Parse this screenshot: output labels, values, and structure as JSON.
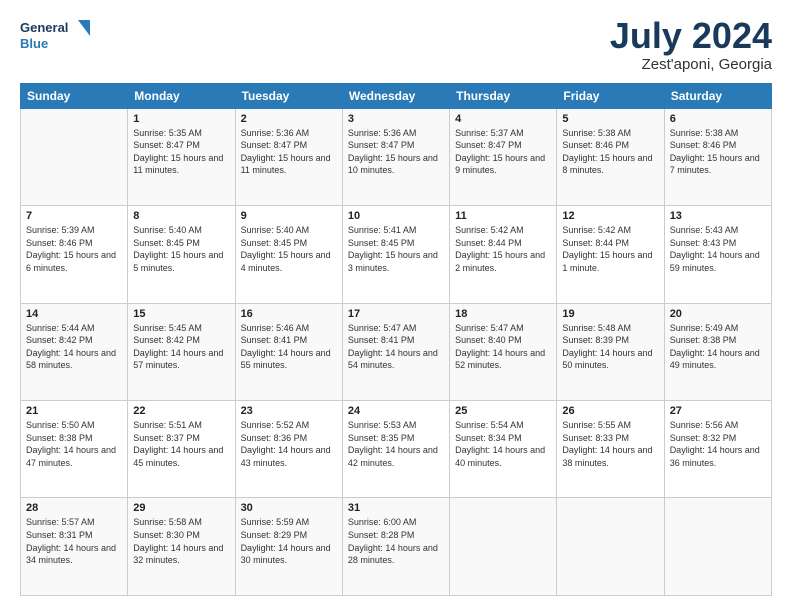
{
  "header": {
    "logo_line1": "General",
    "logo_line2": "Blue",
    "title": "July 2024",
    "location": "Zest'aponi, Georgia"
  },
  "days_of_week": [
    "Sunday",
    "Monday",
    "Tuesday",
    "Wednesday",
    "Thursday",
    "Friday",
    "Saturday"
  ],
  "weeks": [
    [
      {
        "day": "",
        "sunrise": "",
        "sunset": "",
        "daylight": ""
      },
      {
        "day": "1",
        "sunrise": "Sunrise: 5:35 AM",
        "sunset": "Sunset: 8:47 PM",
        "daylight": "Daylight: 15 hours and 11 minutes."
      },
      {
        "day": "2",
        "sunrise": "Sunrise: 5:36 AM",
        "sunset": "Sunset: 8:47 PM",
        "daylight": "Daylight: 15 hours and 11 minutes."
      },
      {
        "day": "3",
        "sunrise": "Sunrise: 5:36 AM",
        "sunset": "Sunset: 8:47 PM",
        "daylight": "Daylight: 15 hours and 10 minutes."
      },
      {
        "day": "4",
        "sunrise": "Sunrise: 5:37 AM",
        "sunset": "Sunset: 8:47 PM",
        "daylight": "Daylight: 15 hours and 9 minutes."
      },
      {
        "day": "5",
        "sunrise": "Sunrise: 5:38 AM",
        "sunset": "Sunset: 8:46 PM",
        "daylight": "Daylight: 15 hours and 8 minutes."
      },
      {
        "day": "6",
        "sunrise": "Sunrise: 5:38 AM",
        "sunset": "Sunset: 8:46 PM",
        "daylight": "Daylight: 15 hours and 7 minutes."
      }
    ],
    [
      {
        "day": "7",
        "sunrise": "Sunrise: 5:39 AM",
        "sunset": "Sunset: 8:46 PM",
        "daylight": "Daylight: 15 hours and 6 minutes."
      },
      {
        "day": "8",
        "sunrise": "Sunrise: 5:40 AM",
        "sunset": "Sunset: 8:45 PM",
        "daylight": "Daylight: 15 hours and 5 minutes."
      },
      {
        "day": "9",
        "sunrise": "Sunrise: 5:40 AM",
        "sunset": "Sunset: 8:45 PM",
        "daylight": "Daylight: 15 hours and 4 minutes."
      },
      {
        "day": "10",
        "sunrise": "Sunrise: 5:41 AM",
        "sunset": "Sunset: 8:45 PM",
        "daylight": "Daylight: 15 hours and 3 minutes."
      },
      {
        "day": "11",
        "sunrise": "Sunrise: 5:42 AM",
        "sunset": "Sunset: 8:44 PM",
        "daylight": "Daylight: 15 hours and 2 minutes."
      },
      {
        "day": "12",
        "sunrise": "Sunrise: 5:42 AM",
        "sunset": "Sunset: 8:44 PM",
        "daylight": "Daylight: 15 hours and 1 minute."
      },
      {
        "day": "13",
        "sunrise": "Sunrise: 5:43 AM",
        "sunset": "Sunset: 8:43 PM",
        "daylight": "Daylight: 14 hours and 59 minutes."
      }
    ],
    [
      {
        "day": "14",
        "sunrise": "Sunrise: 5:44 AM",
        "sunset": "Sunset: 8:42 PM",
        "daylight": "Daylight: 14 hours and 58 minutes."
      },
      {
        "day": "15",
        "sunrise": "Sunrise: 5:45 AM",
        "sunset": "Sunset: 8:42 PM",
        "daylight": "Daylight: 14 hours and 57 minutes."
      },
      {
        "day": "16",
        "sunrise": "Sunrise: 5:46 AM",
        "sunset": "Sunset: 8:41 PM",
        "daylight": "Daylight: 14 hours and 55 minutes."
      },
      {
        "day": "17",
        "sunrise": "Sunrise: 5:47 AM",
        "sunset": "Sunset: 8:41 PM",
        "daylight": "Daylight: 14 hours and 54 minutes."
      },
      {
        "day": "18",
        "sunrise": "Sunrise: 5:47 AM",
        "sunset": "Sunset: 8:40 PM",
        "daylight": "Daylight: 14 hours and 52 minutes."
      },
      {
        "day": "19",
        "sunrise": "Sunrise: 5:48 AM",
        "sunset": "Sunset: 8:39 PM",
        "daylight": "Daylight: 14 hours and 50 minutes."
      },
      {
        "day": "20",
        "sunrise": "Sunrise: 5:49 AM",
        "sunset": "Sunset: 8:38 PM",
        "daylight": "Daylight: 14 hours and 49 minutes."
      }
    ],
    [
      {
        "day": "21",
        "sunrise": "Sunrise: 5:50 AM",
        "sunset": "Sunset: 8:38 PM",
        "daylight": "Daylight: 14 hours and 47 minutes."
      },
      {
        "day": "22",
        "sunrise": "Sunrise: 5:51 AM",
        "sunset": "Sunset: 8:37 PM",
        "daylight": "Daylight: 14 hours and 45 minutes."
      },
      {
        "day": "23",
        "sunrise": "Sunrise: 5:52 AM",
        "sunset": "Sunset: 8:36 PM",
        "daylight": "Daylight: 14 hours and 43 minutes."
      },
      {
        "day": "24",
        "sunrise": "Sunrise: 5:53 AM",
        "sunset": "Sunset: 8:35 PM",
        "daylight": "Daylight: 14 hours and 42 minutes."
      },
      {
        "day": "25",
        "sunrise": "Sunrise: 5:54 AM",
        "sunset": "Sunset: 8:34 PM",
        "daylight": "Daylight: 14 hours and 40 minutes."
      },
      {
        "day": "26",
        "sunrise": "Sunrise: 5:55 AM",
        "sunset": "Sunset: 8:33 PM",
        "daylight": "Daylight: 14 hours and 38 minutes."
      },
      {
        "day": "27",
        "sunrise": "Sunrise: 5:56 AM",
        "sunset": "Sunset: 8:32 PM",
        "daylight": "Daylight: 14 hours and 36 minutes."
      }
    ],
    [
      {
        "day": "28",
        "sunrise": "Sunrise: 5:57 AM",
        "sunset": "Sunset: 8:31 PM",
        "daylight": "Daylight: 14 hours and 34 minutes."
      },
      {
        "day": "29",
        "sunrise": "Sunrise: 5:58 AM",
        "sunset": "Sunset: 8:30 PM",
        "daylight": "Daylight: 14 hours and 32 minutes."
      },
      {
        "day": "30",
        "sunrise": "Sunrise: 5:59 AM",
        "sunset": "Sunset: 8:29 PM",
        "daylight": "Daylight: 14 hours and 30 minutes."
      },
      {
        "day": "31",
        "sunrise": "Sunrise: 6:00 AM",
        "sunset": "Sunset: 8:28 PM",
        "daylight": "Daylight: 14 hours and 28 minutes."
      },
      {
        "day": "",
        "sunrise": "",
        "sunset": "",
        "daylight": ""
      },
      {
        "day": "",
        "sunrise": "",
        "sunset": "",
        "daylight": ""
      },
      {
        "day": "",
        "sunrise": "",
        "sunset": "",
        "daylight": ""
      }
    ]
  ]
}
